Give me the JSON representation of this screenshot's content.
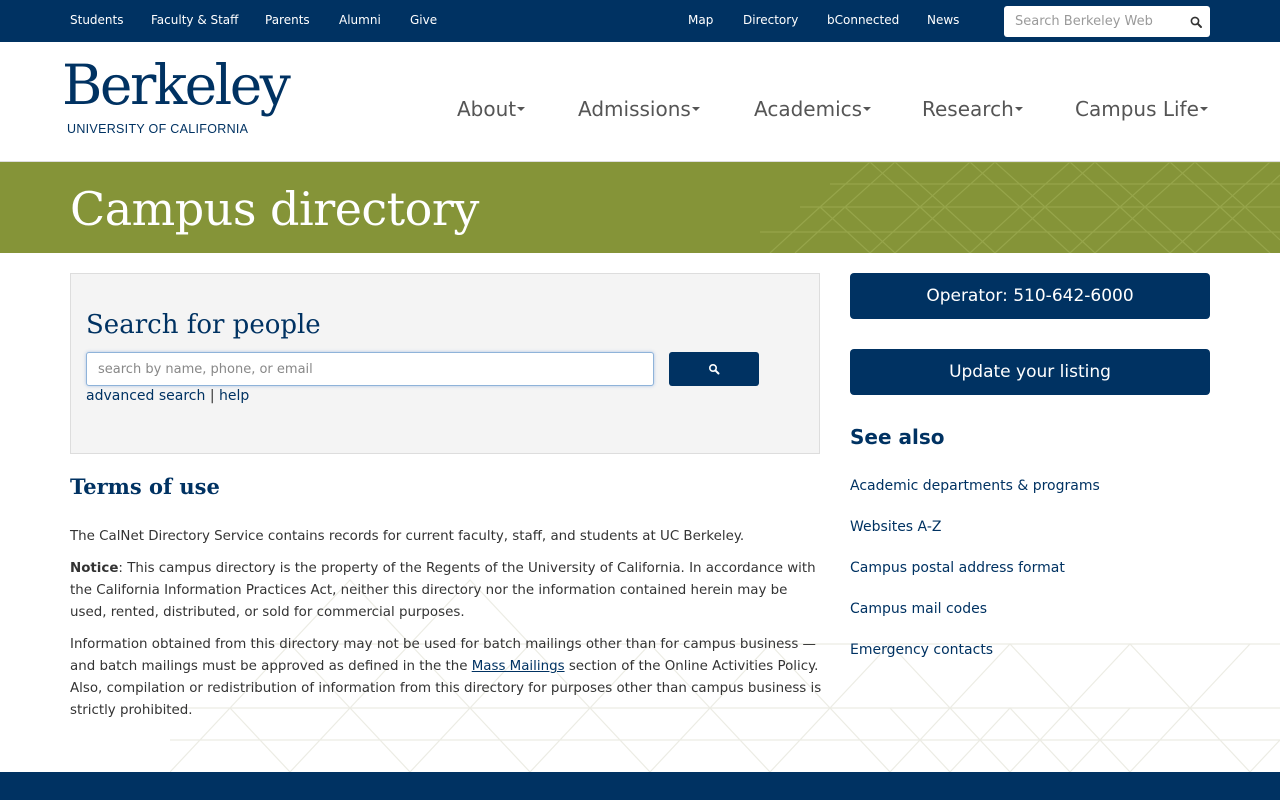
{
  "topbar": {
    "left_links": [
      "Students",
      "Faculty & Staff",
      "Parents",
      "Alumni",
      "Give"
    ],
    "right_links": [
      "Map",
      "Directory",
      "bConnected",
      "News"
    ],
    "search_placeholder": "Search Berkeley Web"
  },
  "logo": {
    "wordmark": "Berkeley",
    "subtitle": "UNIVERSITY OF CALIFORNIA"
  },
  "mainnav": [
    "About",
    "Admissions",
    "Academics",
    "Research",
    "Campus Life"
  ],
  "hero": {
    "title": "Campus directory"
  },
  "search": {
    "title": "Search for people",
    "placeholder": "search by name, phone, or email",
    "advanced_label": "advanced search",
    "separator": "|",
    "help_label": "help"
  },
  "terms": {
    "title": "Terms of use",
    "p1": "The CalNet Directory Service contains records for current faculty, staff, and students at UC Berkeley.",
    "p2_bold": "Notice",
    "p2_rest": ": This campus directory is the property of the Regents of the University of California. In accordance with the California Information Practices Act, neither this directory nor the information contained herein may be used, rented, distributed, or sold for commercial purposes.",
    "p3_before": "Information obtained from this directory may not be used for batch mailings other than for campus business — and batch mailings must be approved as defined in the the ",
    "p3_link": "Mass Mailings",
    "p3_after": " section of the Online Activities Policy. Also, compilation or redistribution of information from this directory for purposes other than campus business is strictly prohibited."
  },
  "sidebar": {
    "operator_label": "Operator: 510-642-6000",
    "update_label": "Update your listing",
    "see_also_title": "See also",
    "links": [
      "Academic departments & programs",
      "Websites A-Z",
      "Campus postal address format",
      "Campus mail codes",
      "Emergency contacts"
    ]
  },
  "colors": {
    "navy": "#003262",
    "olive": "#859438"
  }
}
